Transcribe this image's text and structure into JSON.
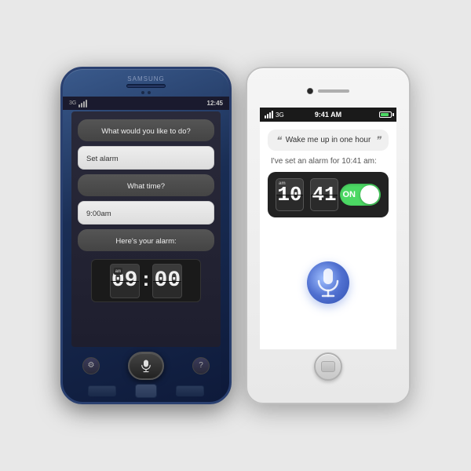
{
  "samsung": {
    "brand": "SAMSUNG",
    "status": {
      "network": "3G",
      "time": "12:45"
    },
    "conversations": [
      {
        "type": "assistant",
        "text": "What would you like to do?"
      },
      {
        "type": "user",
        "text": "Set alarm"
      },
      {
        "type": "assistant",
        "text": "What time?"
      },
      {
        "type": "user",
        "text": "9:00am"
      },
      {
        "type": "assistant",
        "text": "Here's your alarm:"
      }
    ],
    "clock": {
      "hours": "09",
      "minutes": "00",
      "am_pm": "am"
    }
  },
  "iphone": {
    "status": {
      "carrier": "3G",
      "time": "9:41 AM",
      "signal_bars": [
        1,
        2,
        3,
        4
      ]
    },
    "siri": {
      "quote": "Wake me up in one hour",
      "response": "I've set an alarm for 10:41 am:",
      "clock_hours": "10",
      "clock_minutes": "41",
      "am_label": "am",
      "toggle_label": "ON"
    }
  },
  "icons": {
    "mic": "🎤",
    "siri_colors": [
      "#a0c0ff",
      "#5070d0",
      "#3050b0"
    ]
  }
}
